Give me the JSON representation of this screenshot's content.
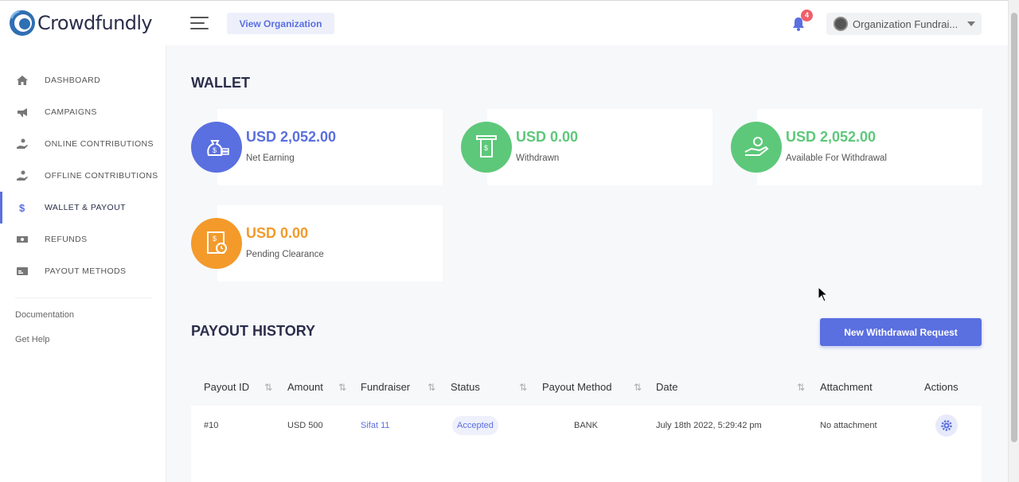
{
  "brand": {
    "name": "Crowdfundly"
  },
  "header": {
    "view_org_label": "View Organization",
    "notification_count": "4",
    "org_name": "Organization Fundrai..."
  },
  "sidebar": {
    "items": [
      {
        "label": "DASHBOARD",
        "icon": "home-icon"
      },
      {
        "label": "CAMPAIGNS",
        "icon": "megaphone-icon"
      },
      {
        "label": "ONLINE CONTRIBUTIONS",
        "icon": "hand-coin-icon"
      },
      {
        "label": "OFFLINE CONTRIBUTIONS",
        "icon": "hand-coin-icon"
      },
      {
        "label": "WALLET & PAYOUT",
        "icon": "dollar-icon",
        "active": true
      },
      {
        "label": "REFUNDS",
        "icon": "money-bill-icon"
      },
      {
        "label": "PAYOUT METHODS",
        "icon": "card-icon"
      }
    ],
    "links": [
      "Documentation",
      "Get Help"
    ]
  },
  "wallet": {
    "title": "WALLET",
    "cards": [
      {
        "amount": "USD 2,052.00",
        "label": "Net Earning",
        "color": "#5a6fe0",
        "icon": "money-bag-icon"
      },
      {
        "amount": "USD 0.00",
        "label": "Withdrawn",
        "color": "#5dc87a",
        "icon": "atm-withdraw-icon"
      },
      {
        "amount": "USD 2,052.00",
        "label": "Available For Withdrawal",
        "color": "#5dc87a",
        "icon": "hand-coins-icon"
      },
      {
        "amount": "USD 0.00",
        "label": "Pending Clearance",
        "color": "#f39a2b",
        "icon": "receipt-clock-icon"
      }
    ]
  },
  "payout_history": {
    "title": "PAYOUT HISTORY",
    "new_request_label": "New Withdrawal Request",
    "columns": [
      "Payout ID",
      "Amount",
      "Fundraiser",
      "Status",
      "Payout Method",
      "Date",
      "Attachment",
      "Actions"
    ],
    "rows": [
      {
        "id": "#10",
        "amount": "USD 500",
        "fundraiser": "Sifat 11",
        "status": "Accepted",
        "method": "BANK",
        "date": "July 18th 2022, 5:29:42 pm",
        "attachment": "No attachment"
      }
    ]
  }
}
